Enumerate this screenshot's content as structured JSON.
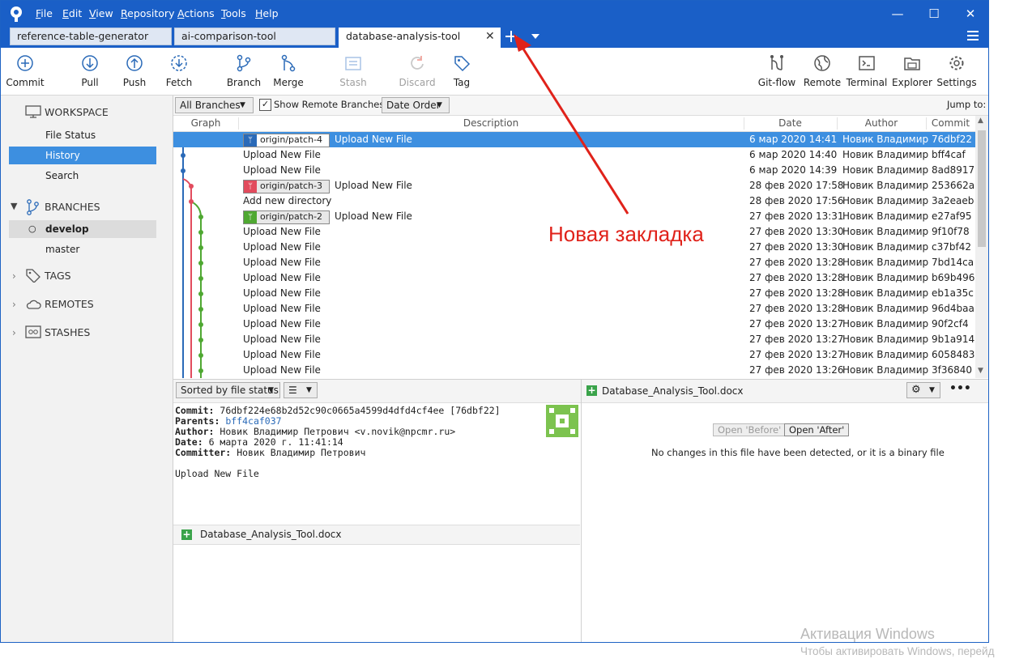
{
  "menu": [
    "File",
    "Edit",
    "View",
    "Repository",
    "Actions",
    "Tools",
    "Help"
  ],
  "tabs": [
    {
      "label": "reference-table-generator"
    },
    {
      "label": "ai-comparison-tool"
    },
    {
      "label": "database-analysis-tool"
    }
  ],
  "window_controls": {
    "minimize": "—",
    "maximize": "☐",
    "close": "✕"
  },
  "toolbar": {
    "commit": "Commit",
    "pull": "Pull",
    "push": "Push",
    "fetch": "Fetch",
    "branch": "Branch",
    "merge": "Merge",
    "stash": "Stash",
    "discard": "Discard",
    "tag": "Tag",
    "gitflow": "Git-flow",
    "remote": "Remote",
    "terminal": "Terminal",
    "explorer": "Explorer",
    "settings": "Settings"
  },
  "sidebar": {
    "workspace": "WORKSPACE",
    "file_status": "File Status",
    "history": "History",
    "search": "Search",
    "branches": "BRANCHES",
    "develop": "develop",
    "master": "master",
    "tags": "TAGS",
    "remotes": "REMOTES",
    "stashes": "STASHES"
  },
  "filterbar": {
    "branches_select": "All Branches",
    "show_remote": "Show Remote Branches",
    "order_select": "Date Order",
    "jump_to": "Jump to:"
  },
  "grid": {
    "columns": {
      "graph": "Graph",
      "description": "Description",
      "date": "Date",
      "author": "Author",
      "commit": "Commit"
    },
    "rows": [
      {
        "badge": "origin/patch-4",
        "desc": "Upload New File",
        "date": "6 мар 2020 14:41",
        "author": "Новик Владимир",
        "hash": "76dbf22"
      },
      {
        "badge": "",
        "desc": "Upload New File",
        "date": "6 мар 2020 14:40",
        "author": "Новик Владимир",
        "hash": "bff4caf"
      },
      {
        "badge": "",
        "desc": "Upload New File",
        "date": "6 мар 2020 14:39",
        "author": "Новик Владимир",
        "hash": "8ad8917"
      },
      {
        "badge": "origin/patch-3",
        "desc": "Upload New File",
        "date": "28 фев 2020 17:58",
        "author": "Новик Владимир",
        "hash": "253662a"
      },
      {
        "badge": "",
        "desc": "Add new directory",
        "date": "28 фев 2020 17:56",
        "author": "Новик Владимир",
        "hash": "3a2eaeb"
      },
      {
        "badge": "origin/patch-2",
        "desc": "Upload New File",
        "date": "27 фев 2020 13:31",
        "author": "Новик Владимир",
        "hash": "e27af95"
      },
      {
        "badge": "",
        "desc": "Upload New File",
        "date": "27 фев 2020 13:30",
        "author": "Новик Владимир",
        "hash": "9f10f78"
      },
      {
        "badge": "",
        "desc": "Upload New File",
        "date": "27 фев 2020 13:30",
        "author": "Новик Владимир",
        "hash": "c37bf42"
      },
      {
        "badge": "",
        "desc": "Upload New File",
        "date": "27 фев 2020 13:28",
        "author": "Новик Владимир",
        "hash": "7bd14ca"
      },
      {
        "badge": "",
        "desc": "Upload New File",
        "date": "27 фев 2020 13:28",
        "author": "Новик Владимир",
        "hash": "b69b496"
      },
      {
        "badge": "",
        "desc": "Upload New File",
        "date": "27 фев 2020 13:28",
        "author": "Новик Владимир",
        "hash": "eb1a35c"
      },
      {
        "badge": "",
        "desc": "Upload New File",
        "date": "27 фев 2020 13:28",
        "author": "Новик Владимир",
        "hash": "96d4baa"
      },
      {
        "badge": "",
        "desc": "Upload New File",
        "date": "27 фев 2020 13:27",
        "author": "Новик Владимир",
        "hash": "90f2cf4"
      },
      {
        "badge": "",
        "desc": "Upload New File",
        "date": "27 фев 2020 13:27",
        "author": "Новик Владимир",
        "hash": "9b1a914"
      },
      {
        "badge": "",
        "desc": "Upload New File",
        "date": "27 фев 2020 13:27",
        "author": "Новик Владимир",
        "hash": "6058483"
      },
      {
        "badge": "",
        "desc": "Upload New File",
        "date": "27 фев 2020 13:26",
        "author": "Новик Владимир",
        "hash": "3f36840"
      }
    ]
  },
  "details": {
    "sort_select": "Sorted by file status",
    "commit_label": "Commit:",
    "commit_value": "76dbf224e68b2d52c90c0665a4599d4dfd4cf4ee [76dbf22]",
    "parents_label": "Parents:",
    "parents_value": "bff4caf037",
    "author_label": "Author:",
    "author_value": "Новик Владимир Петрович <v.novik@npcmr.ru>",
    "date_label": "Date:",
    "date_value": "6 марта 2020 г. 11:41:14",
    "committer_label": "Committer:",
    "committer_value": "Новик Владимир Петрович",
    "message": "Upload New File",
    "file": "Database_Analysis_Tool.docx"
  },
  "diff": {
    "file": "Database_Analysis_Tool.docx",
    "open_before": "Open 'Before'",
    "open_after": "Open 'After'",
    "no_changes": "No changes in this file have been detected, or it is a binary file"
  },
  "annotation": "Новая закладка",
  "watermark": {
    "line1": "Активация Windows",
    "line2": "Чтобы активировать Windows, перейд"
  },
  "colors": {
    "accent": "#1a5fc7",
    "selection": "#3d8fe0",
    "lane_blue": "#2a6ab8",
    "lane_red": "#e24b5d",
    "lane_green": "#4fa832",
    "annotation": "#e0221a"
  }
}
